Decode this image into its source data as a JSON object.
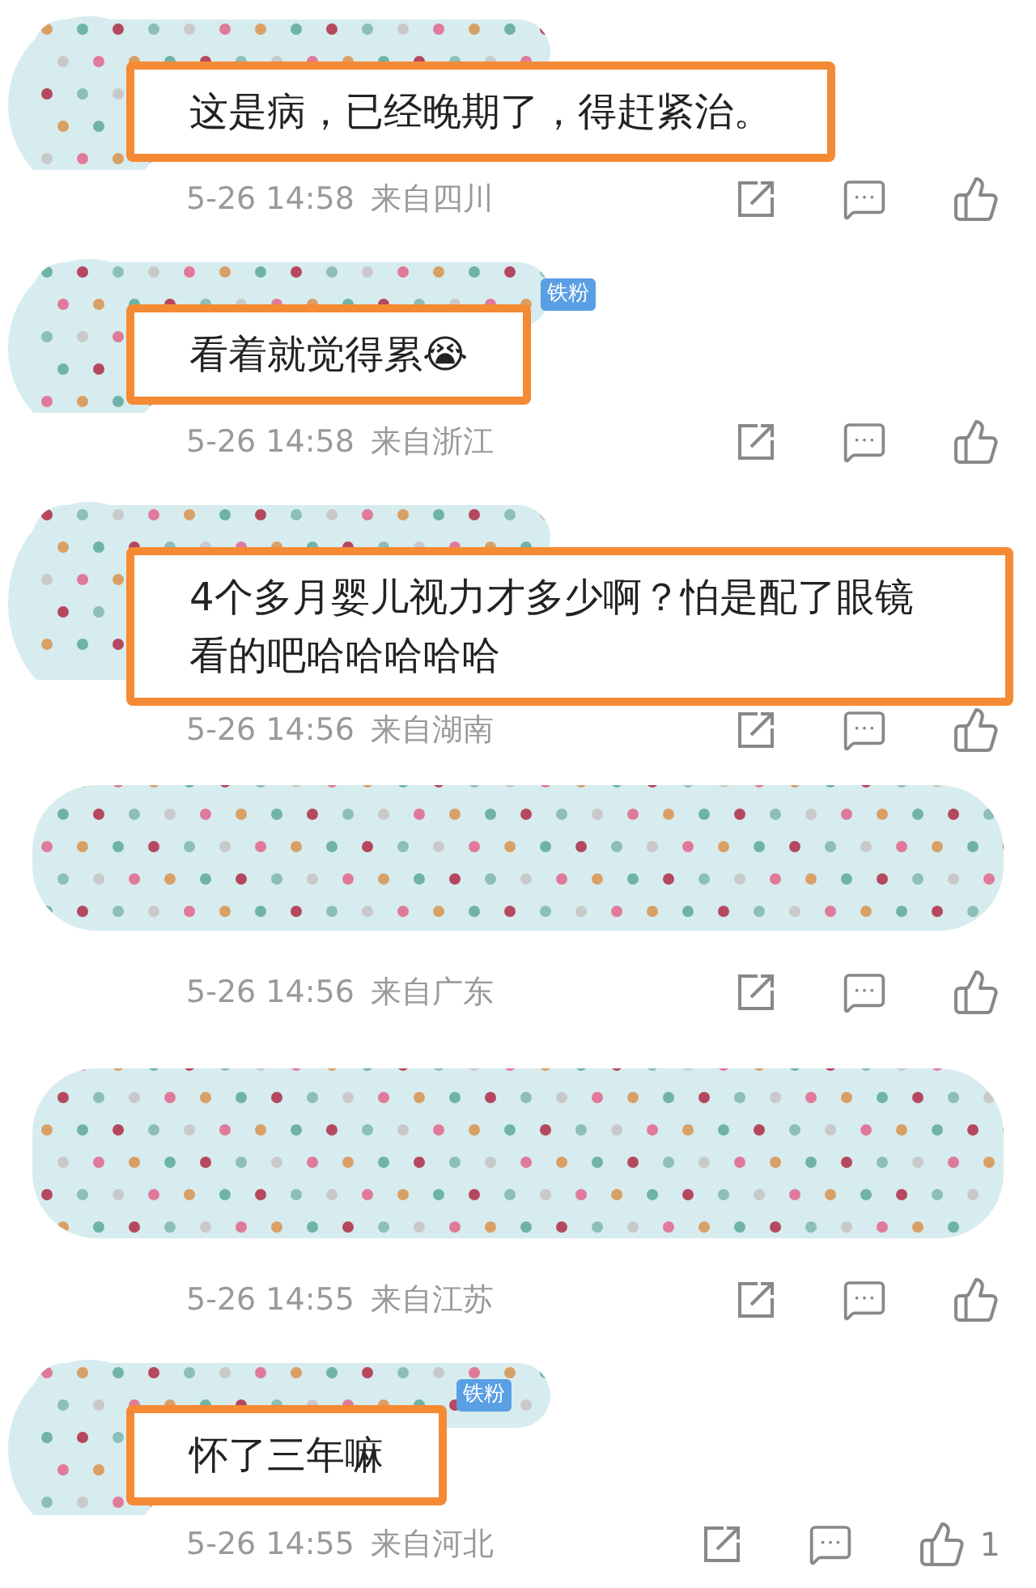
{
  "comments": [
    {
      "kind": "text",
      "text": "这是病，已经晚期了，得赶紧治。",
      "highlighted": true,
      "time": "5-26 14:58",
      "location": "来自四川"
    },
    {
      "kind": "text",
      "badge": "铁粉",
      "text": "看着就觉得累😭",
      "highlighted": true,
      "time": "5-26 14:58",
      "location": "来自浙江"
    },
    {
      "kind": "text",
      "text": "4个多月婴儿视力才多少啊？怕是配了眼镜看的吧哈哈哈哈哈",
      "highlighted": true,
      "time": "5-26 14:56",
      "location": "来自湖南"
    },
    {
      "kind": "redacted",
      "time": "5-26 14:56",
      "location": "来自广东"
    },
    {
      "kind": "redacted",
      "time": "5-26 14:55",
      "location": "来自江苏"
    },
    {
      "kind": "text",
      "badge": "铁粉",
      "text": "怀了三年嘛",
      "highlighted": true,
      "time": "5-26 14:55",
      "location": "来自河北",
      "like_count": "1"
    }
  ]
}
